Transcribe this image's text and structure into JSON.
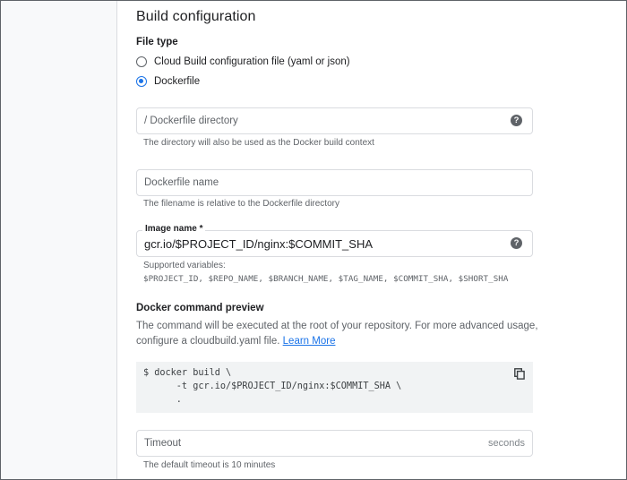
{
  "section": {
    "title": "Build configuration"
  },
  "file_type": {
    "label": "File type",
    "options": [
      {
        "label": "Cloud Build configuration file (yaml or json)",
        "selected": false
      },
      {
        "label": "Dockerfile",
        "selected": true
      }
    ]
  },
  "dockerfile_directory": {
    "placeholder": "/ Dockerfile directory",
    "hint": "The directory will also be used as the Docker build context"
  },
  "dockerfile_name": {
    "placeholder": "Dockerfile name",
    "hint": "The filename is relative to the Dockerfile directory"
  },
  "image_name": {
    "label": "Image name *",
    "value": "gcr.io/$PROJECT_ID/nginx:$COMMIT_SHA",
    "hint_title": "Supported variables:",
    "variables": "$PROJECT_ID, $REPO_NAME, $BRANCH_NAME, $TAG_NAME, $COMMIT_SHA, $SHORT_SHA"
  },
  "preview": {
    "title": "Docker command preview",
    "description_line1": "The command will be executed at the root of your repository. For more advanced usage,",
    "description_line2": "configure a cloudbuild.yaml file.",
    "learn_more": "Learn More",
    "code": [
      "$ docker build \\",
      "      -t gcr.io/$PROJECT_ID/nginx:$COMMIT_SHA \\",
      "      ."
    ]
  },
  "timeout": {
    "placeholder": "Timeout",
    "suffix": "seconds",
    "hint": "The default timeout is 10 minutes"
  },
  "colors": {
    "accent": "#1a73e8",
    "border": "#dadce0",
    "secondary_text": "#5f6368",
    "code_bg": "#f1f3f4"
  },
  "icons": {
    "help": "help-circle-icon",
    "copy": "copy-icon"
  }
}
